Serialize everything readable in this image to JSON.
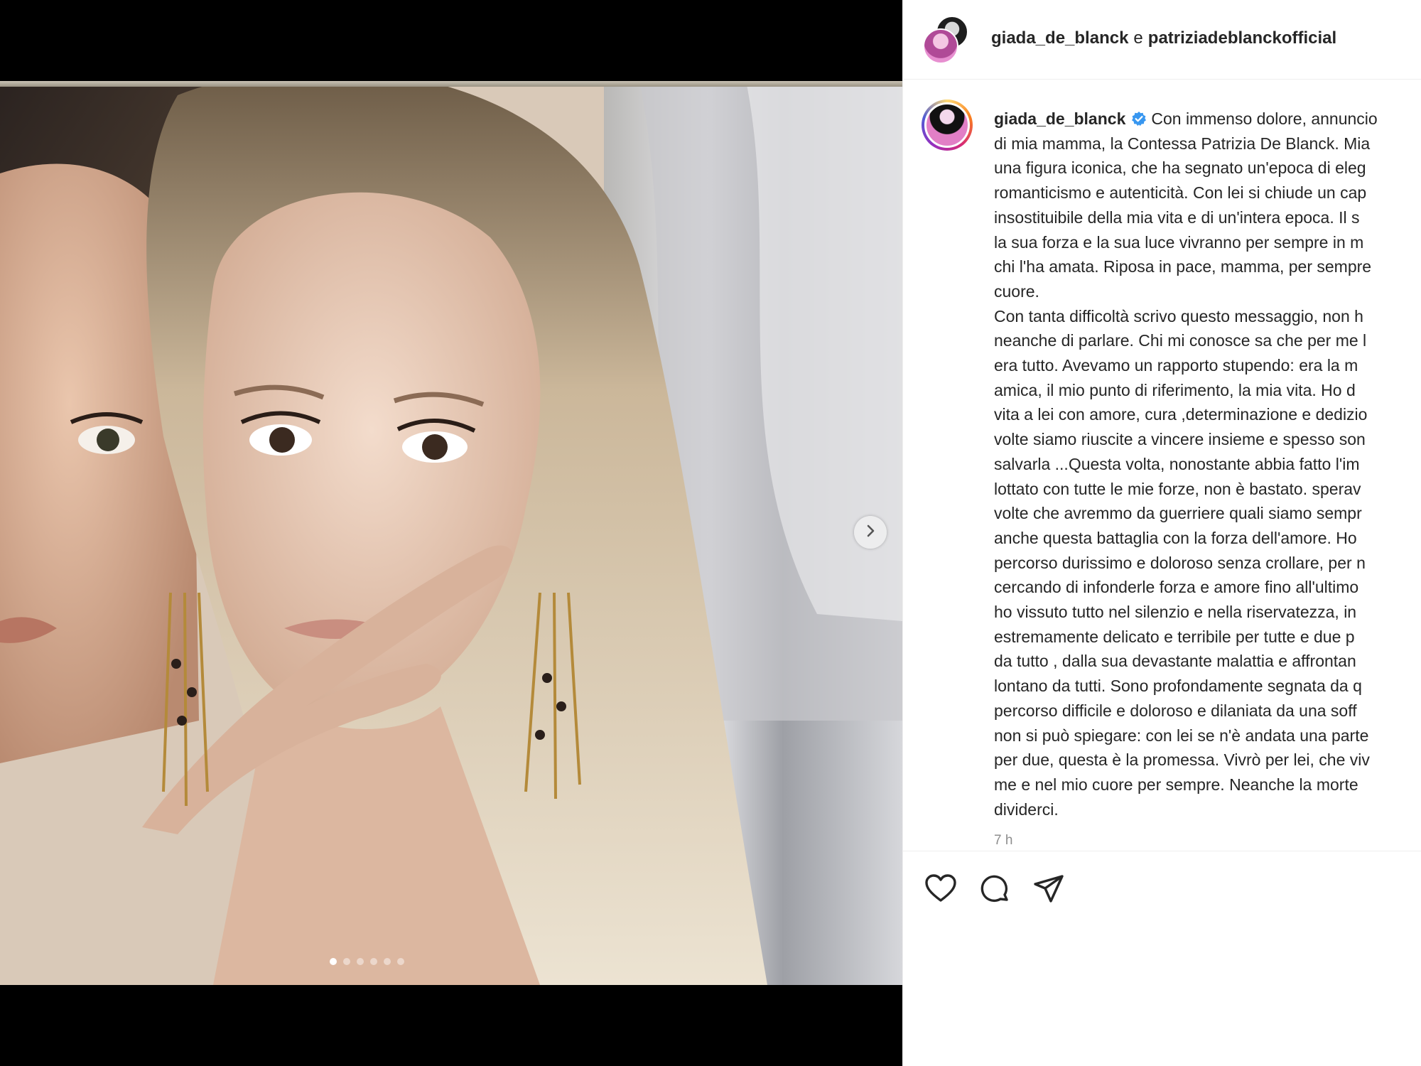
{
  "post": {
    "collaborators": {
      "user1": "giada_de_blanck",
      "conjunction": "e",
      "user2": "patriziadeblanckofficial"
    },
    "caption_user": "giada_de_blanck",
    "caption_lines": [
      "Con immenso dolore, annuncio",
      "di mia mamma, la Contessa Patrizia De Blanck. Mia",
      "una figura iconica, che ha segnato un'epoca di eleg",
      "romanticismo e autenticità. Con lei si chiude un cap",
      "insostituibile della mia vita e di un'intera epoca. Il s",
      "la sua forza e la sua luce vivranno per sempre in m",
      "chi l'ha amata. Riposa in pace, mamma, per sempre",
      "cuore.",
      "Con tanta difficoltà scrivo questo messaggio, non h",
      "neanche di parlare. Chi mi conosce sa che per me l",
      "era tutto. Avevamo un rapporto stupendo: era la m",
      "amica, il mio punto di riferimento, la mia vita. Ho d",
      "vita a lei con amore, cura ,determinazione e dedizio",
      "volte siamo riuscite a vincere insieme e spesso son",
      "salvarla ...Questa volta, nonostante abbia fatto l'im",
      "lottato con tutte le mie forze, non è bastato. sperav",
      "volte che avremmo da guerriere quali siamo sempr",
      "anche questa battaglia con la forza dell'amore. Ho",
      "percorso durissimo e doloroso senza crollare, per n",
      "cercando di infonderle forza e amore fino all'ultimo",
      "ho vissuto tutto nel silenzio e nella riservatezza, in",
      "estremamente delicato e terribile per tutte e due p",
      "da tutto , dalla sua devastante malattia e affrontan",
      "lontano da tutti. Sono profondamente segnata da q",
      "percorso difficile e doloroso e dilaniata da una soff",
      "non si può spiegare: con lei se n'è andata una parte",
      "per due, questa è la promessa. Vivrò per lei, che viv",
      "me e nel mio cuore per sempre. Neanche la morte",
      "dividerci."
    ],
    "timestamp": "7 h",
    "carousel": {
      "total": 6,
      "active_index": 0
    }
  },
  "icons": {
    "verified": "verified-badge-icon",
    "next": "chevron-right-icon",
    "like": "heart-icon",
    "comment": "comment-icon",
    "share": "paper-plane-icon"
  },
  "colors": {
    "verified_blue": "#3897f0",
    "text": "#262626",
    "muted": "#8e8e8e",
    "divider": "#efefef"
  }
}
